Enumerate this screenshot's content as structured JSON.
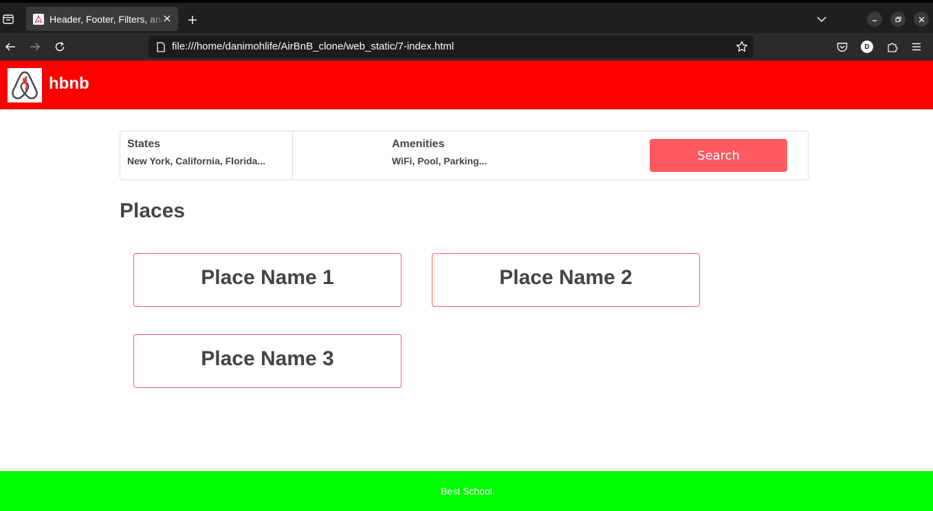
{
  "browser": {
    "tab_title": "Header, Footer, Filters, and Places",
    "url": "file:///home/danimohlife/AirBnB_clone/web_static/7-index.html",
    "account_initial": "D"
  },
  "header": {
    "brand": "hbnb"
  },
  "filters": {
    "states": {
      "title": "States",
      "items": "New York, California, Florida..."
    },
    "amenities": {
      "title": "Amenities",
      "items": "WiFi, Pool, Parking..."
    },
    "search_label": "Search"
  },
  "places": {
    "title": "Places",
    "items": [
      {
        "name": "Place Name 1"
      },
      {
        "name": "Place Name 2"
      },
      {
        "name": "Place Name 3"
      }
    ]
  },
  "footer": {
    "text": "Best School"
  },
  "colors": {
    "header_bg": "#ff0000",
    "footer_bg": "#00ff00",
    "accent": "#ff5a5f",
    "text": "#444444"
  }
}
